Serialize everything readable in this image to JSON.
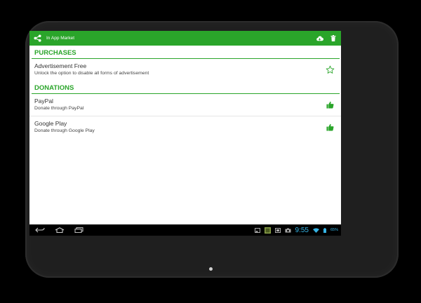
{
  "app_bar": {
    "title": "In App Market",
    "icons": [
      "share-icon",
      "cloud-icon",
      "trash-icon"
    ]
  },
  "sections": [
    {
      "header": "PURCHASES",
      "items": [
        {
          "title": "Advertisement Free",
          "subtitle": "Unlock the option to disable all forms of advertisement",
          "icon": "star-outline-icon"
        }
      ]
    },
    {
      "header": "DONATIONS",
      "items": [
        {
          "title": "PayPal",
          "subtitle": "Donate through PayPal",
          "icon": "thumbs-up-icon"
        },
        {
          "title": "Google Play",
          "subtitle": "Donate through Google Play",
          "icon": "thumbs-up-icon"
        }
      ]
    }
  ],
  "system_bar": {
    "time": "9:55",
    "battery": "65%",
    "icons": [
      "back-icon",
      "home-icon",
      "recents-icon",
      "gallery-icon",
      "app-thumb-icon",
      "screenshot-icon",
      "camera-icon",
      "wifi-icon",
      "battery-icon"
    ]
  },
  "colors": {
    "accent": "#2aa52a",
    "status_text": "#36b4e5"
  }
}
